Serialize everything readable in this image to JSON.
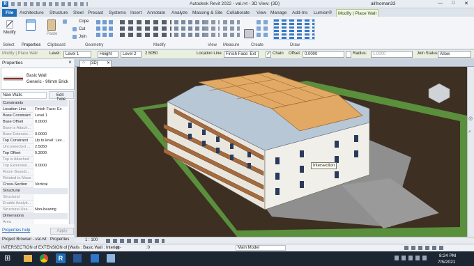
{
  "app": {
    "title": "Autodesk Revit 2022 - val.rvt - 3D View: {3D}",
    "user": "alifnoman33"
  },
  "tabs": [
    "File",
    "Architecture",
    "Structure",
    "Steel",
    "Precast",
    "Systems",
    "Insert",
    "Annotate",
    "Analyze",
    "Massing & Site",
    "Collaborate",
    "View",
    "Manage",
    "Add-Ins",
    "Lumion®",
    "Modify | Place Wall"
  ],
  "ribbon": {
    "modify": "Modify",
    "properties": "Properties",
    "paste": "Paste",
    "cope": "Cope",
    "cut": "Cut",
    "join": "Join",
    "panels": {
      "select": "Select",
      "properties": "Properties",
      "clipboard": "Clipboard",
      "geometry": "Geometry",
      "modify": "Modify",
      "view": "View",
      "measure": "Measure",
      "create": "Create",
      "draw": "Draw"
    }
  },
  "options": {
    "context": "Modify | Place Wall",
    "level_label": "Level:",
    "level": "Level 1",
    "height_label": "Height",
    "height_target": "Level 2",
    "height_value": "2.5050",
    "location_label": "Location Line:",
    "location": "Finish Face: Ext",
    "chain": "Chain",
    "offset_label": "Offset:",
    "offset": "0.0000",
    "radius_label": "Radius:",
    "radius": "1.0000",
    "join_label": "Join Status:",
    "join": "Allow"
  },
  "properties": {
    "header": "Properties",
    "type_family": "Basic Wall",
    "type_name": "Generic - 90mm Brick",
    "selector": "New Walls",
    "edit_type": "Edit Type",
    "groups": [
      {
        "name": "Constraints",
        "rows": [
          {
            "k": "Location Line",
            "v": "Finish Face: Ex",
            "dim": false
          },
          {
            "k": "Base Constraint",
            "v": "Level 1",
            "dim": false
          },
          {
            "k": "Base Offset",
            "v": "0.0000",
            "dim": false
          },
          {
            "k": "Base is Attach...",
            "v": "",
            "dim": true
          },
          {
            "k": "Base Extensio...",
            "v": "0.0000",
            "dim": true
          },
          {
            "k": "Top Constraint",
            "v": "Up to level: Lev...",
            "dim": false
          },
          {
            "k": "Unconnected ...",
            "v": "2.5050",
            "dim": true
          },
          {
            "k": "Top Offset",
            "v": "0.3000",
            "dim": false
          },
          {
            "k": "Top is Attached",
            "v": "",
            "dim": true
          },
          {
            "k": "Top Extension...",
            "v": "0.0000",
            "dim": true
          },
          {
            "k": "Room Boundi...",
            "v": "",
            "dim": true
          },
          {
            "k": "Related to Mass",
            "v": "",
            "dim": true
          },
          {
            "k": "Cross-Section",
            "v": "Vertical",
            "dim": false
          }
        ]
      },
      {
        "name": "Structural",
        "rows": [
          {
            "k": "Structural",
            "v": "",
            "dim": true
          },
          {
            "k": "Enable Analyti...",
            "v": "",
            "dim": true
          },
          {
            "k": "Structural Usa...",
            "v": "Non-bearing",
            "dim": true
          }
        ]
      },
      {
        "name": "Dimensions",
        "rows": [
          {
            "k": "Area",
            "v": "",
            "dim": true
          }
        ]
      }
    ],
    "help": "Properties help",
    "apply": "Apply"
  },
  "view": {
    "tab": "{3D}",
    "tooltip": "Intersection",
    "scale": "1 : 100"
  },
  "bottom_tabs": [
    "Project Browser - val.rvt",
    "Properties"
  ],
  "status": {
    "message": "INTERSECTION of EXTENSION of [Walls : Basic Wall : Interior -",
    "zero": ":0",
    "model": "Main Model"
  },
  "taskbar": {
    "time": "8:24 PM",
    "date": "7/5/2021"
  }
}
